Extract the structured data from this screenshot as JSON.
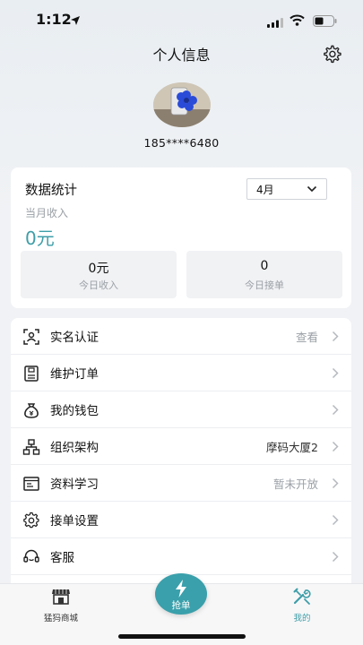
{
  "status_bar": {
    "time": "1:12",
    "icons": [
      "location-arrow-icon",
      "signal-icon",
      "wifi-icon",
      "battery-icon"
    ]
  },
  "header": {
    "title": "个人信息",
    "settings_icon": "gear-icon"
  },
  "profile": {
    "phone": "185****6480"
  },
  "stats": {
    "title": "数据统计",
    "month": "4月",
    "month_income_label": "当月收入",
    "month_income_value": "0元",
    "today_income_value": "0元",
    "today_income_label": "今日收入",
    "today_orders_value": "0",
    "today_orders_label": "今日接单"
  },
  "menu": [
    {
      "label": "实名认证",
      "value": "查看",
      "icon": "id-card-icon"
    },
    {
      "label": "维护订单",
      "value": "",
      "icon": "clipboard-icon"
    },
    {
      "label": "我的钱包",
      "value": "",
      "icon": "money-bag-icon"
    },
    {
      "label": "组织架构",
      "value": "摩码大厦2",
      "icon": "org-chart-icon"
    },
    {
      "label": "资料学习",
      "value": "暂未开放",
      "icon": "document-icon"
    },
    {
      "label": "接单设置",
      "value": "",
      "icon": "gear-icon"
    },
    {
      "label": "客服",
      "value": "",
      "icon": "headset-icon"
    }
  ],
  "tab_bar": {
    "shop_label": "猛犸商城",
    "grab_label": "抢单",
    "mine_label": "我的"
  },
  "colors": {
    "accent": "#3e9ea8",
    "grab_button": "#3aa0ab",
    "muted_text": "#9aa0a6"
  }
}
